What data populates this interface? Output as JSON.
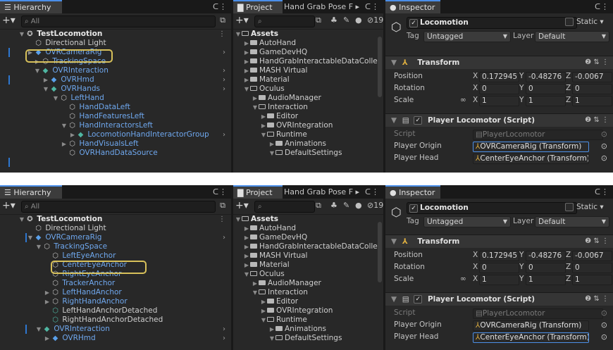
{
  "colors": {
    "accent": "#4a8ee8",
    "highlight": "#d7c05a",
    "background": "#282828",
    "selected_text": "#6fa8ef"
  },
  "hierarchy": {
    "tab_label": "Hierarchy",
    "search_placeholder": "All",
    "top_rows": [
      {
        "label": "TestLocomotion",
        "icon": "unity-scene-icon"
      },
      {
        "label": "Directional Light",
        "icon": "gameobject-icon"
      },
      {
        "label": "OVRCameraRig",
        "icon": "prefab-icon"
      },
      {
        "label": "TrackingSpace",
        "icon": "gameobject-icon"
      },
      {
        "label": "OVRInteraction",
        "icon": "prefab-icon"
      },
      {
        "label": "OVRHmd",
        "icon": "prefab-icon"
      },
      {
        "label": "OVRHands",
        "icon": "prefab-icon"
      },
      {
        "label": "LeftHand",
        "icon": "gameobject-icon"
      },
      {
        "label": "HandDataLeft",
        "icon": "gameobject-icon"
      },
      {
        "label": "HandFeaturesLeft",
        "icon": "gameobject-icon"
      },
      {
        "label": "HandInteractorsLeft",
        "icon": "gameobject-icon"
      },
      {
        "label": "LocomotionHandInteractorGroup",
        "icon": "prefab-icon"
      },
      {
        "label": "HandVisualsLeft",
        "icon": "gameobject-icon"
      },
      {
        "label": "OVRHandDataSource",
        "icon": "gameobject-icon"
      }
    ],
    "bottom_rows": [
      {
        "label": "TestLocomotion",
        "icon": "unity-scene-icon"
      },
      {
        "label": "Directional Light",
        "icon": "gameobject-icon"
      },
      {
        "label": "OVRCameraRig",
        "icon": "prefab-icon"
      },
      {
        "label": "TrackingSpace",
        "icon": "gameobject-icon"
      },
      {
        "label": "LeftEyeAnchor",
        "icon": "gameobject-icon"
      },
      {
        "label": "CenterEyeAnchor",
        "icon": "gameobject-icon"
      },
      {
        "label": "RightEyeAnchor",
        "icon": "gameobject-icon"
      },
      {
        "label": "TrackerAnchor",
        "icon": "gameobject-icon"
      },
      {
        "label": "LeftHandAnchor",
        "icon": "gameobject-icon"
      },
      {
        "label": "RightHandAnchor",
        "icon": "gameobject-icon"
      },
      {
        "label": "LeftHandAnchorDetached",
        "icon": "gameobject-icon"
      },
      {
        "label": "RightHandAnchorDetached",
        "icon": "gameobject-icon"
      },
      {
        "label": "OVRInteraction",
        "icon": "prefab-icon"
      },
      {
        "label": "OVRHmd",
        "icon": "prefab-icon"
      }
    ]
  },
  "project": {
    "tab_label": "Project",
    "tab2_label": "Hand Grab Pose F",
    "hidden_count": "19",
    "rows": [
      {
        "label": "Assets",
        "icon": "folder-open-icon"
      },
      {
        "label": "AutoHand",
        "icon": "folder-icon"
      },
      {
        "label": "GameDevHQ",
        "icon": "folder-icon"
      },
      {
        "label": "HandGrabInteractableDataColle",
        "icon": "folder-icon"
      },
      {
        "label": "MASH Virtual",
        "icon": "folder-icon"
      },
      {
        "label": "Material",
        "icon": "folder-icon"
      },
      {
        "label": "Oculus",
        "icon": "folder-open-icon"
      },
      {
        "label": "AudioManager",
        "icon": "folder-icon"
      },
      {
        "label": "Interaction",
        "icon": "folder-open-icon"
      },
      {
        "label": "Editor",
        "icon": "folder-icon"
      },
      {
        "label": "OVRIntegration",
        "icon": "folder-icon"
      },
      {
        "label": "Runtime",
        "icon": "folder-open-icon"
      },
      {
        "label": "Animations",
        "icon": "folder-icon"
      },
      {
        "label": "DefaultSettings",
        "icon": "folder-open-icon"
      }
    ]
  },
  "inspector": {
    "tab_label": "Inspector",
    "object_name": "Locomotion",
    "static_label": "Static",
    "tag_label": "Tag",
    "tag_value": "Untagged",
    "layer_label": "Layer",
    "layer_value": "Default",
    "transform": {
      "title": "Transform",
      "position_label": "Position",
      "position": {
        "x": "0.172945",
        "y": "-0.48276",
        "z": "-0.0067"
      },
      "rotation_label": "Rotation",
      "rotation": {
        "x": "0",
        "y": "0",
        "z": "0"
      },
      "scale_label": "Scale",
      "scale": {
        "x": "1",
        "y": "1",
        "z": "1"
      }
    },
    "script_comp": {
      "title": "Player Locomotor (Script)",
      "script_label": "Script",
      "script_value": "PlayerLocomotor",
      "origin_label": "Player Origin",
      "origin_value": "OVRCameraRig (Transform)",
      "head_label": "Player Head",
      "head_value": "CenterEyeAnchor (Transform)"
    }
  }
}
